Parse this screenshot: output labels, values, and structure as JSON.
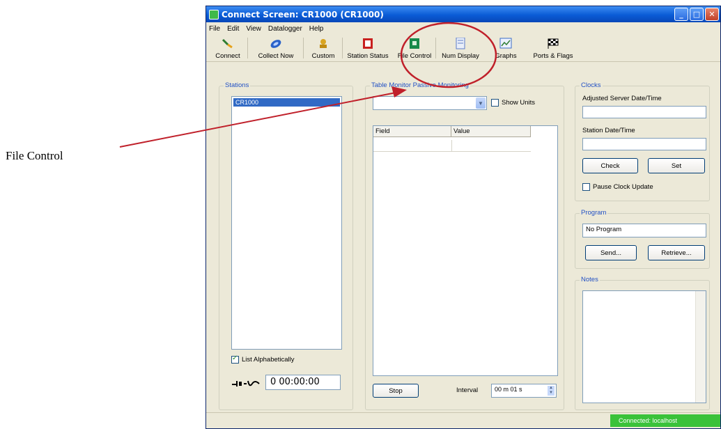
{
  "annotation": {
    "label": "File Control"
  },
  "window": {
    "title": "Connect Screen: CR1000 (CR1000)",
    "buttons": {
      "minimize": "_",
      "maximize": "□",
      "close": "✕"
    }
  },
  "menu": [
    "File",
    "Edit",
    "View",
    "Datalogger",
    "Help"
  ],
  "toolbar": [
    {
      "label": "Connect",
      "icon": "connect-icon"
    },
    {
      "label": "Collect Now",
      "icon": "collect-now-icon"
    },
    {
      "label": "Custom",
      "icon": "custom-icon"
    },
    {
      "label": "Station Status",
      "icon": "station-status-icon"
    },
    {
      "label": "File Control",
      "icon": "file-control-icon"
    },
    {
      "label": "Num Display",
      "icon": "num-display-icon"
    },
    {
      "label": "Graphs",
      "icon": "graphs-icon"
    },
    {
      "label": "Ports & Flags",
      "icon": "ports-flags-icon"
    }
  ],
  "stations": {
    "title": "Stations",
    "items": [
      "CR1000"
    ],
    "list_alpha_label": "List Alphabetically",
    "timer": "0 00:00:00"
  },
  "monitor": {
    "title": "Table Monitor Passive Monitoring",
    "show_units_label": "Show Units",
    "columns": [
      "Field",
      "Value"
    ],
    "stop_label": "Stop",
    "interval_label": "Interval",
    "interval_value": "00 m 01 s"
  },
  "clocks": {
    "title": "Clocks",
    "adjusted_label": "Adjusted Server Date/Time",
    "adjusted_value": "",
    "station_label": "Station Date/Time",
    "station_value": "",
    "check_label": "Check",
    "set_label": "Set",
    "pause_label": "Pause Clock Update"
  },
  "program": {
    "title": "Program",
    "value": "No Program",
    "send_label": "Send...",
    "retrieve_label": "Retrieve..."
  },
  "notes": {
    "title": "Notes"
  },
  "status": {
    "connection": "Connected: localhost"
  },
  "colors": {
    "annotation_red": "#c0202a",
    "selection": "#316ac5",
    "status_green": "#3ac23a"
  }
}
